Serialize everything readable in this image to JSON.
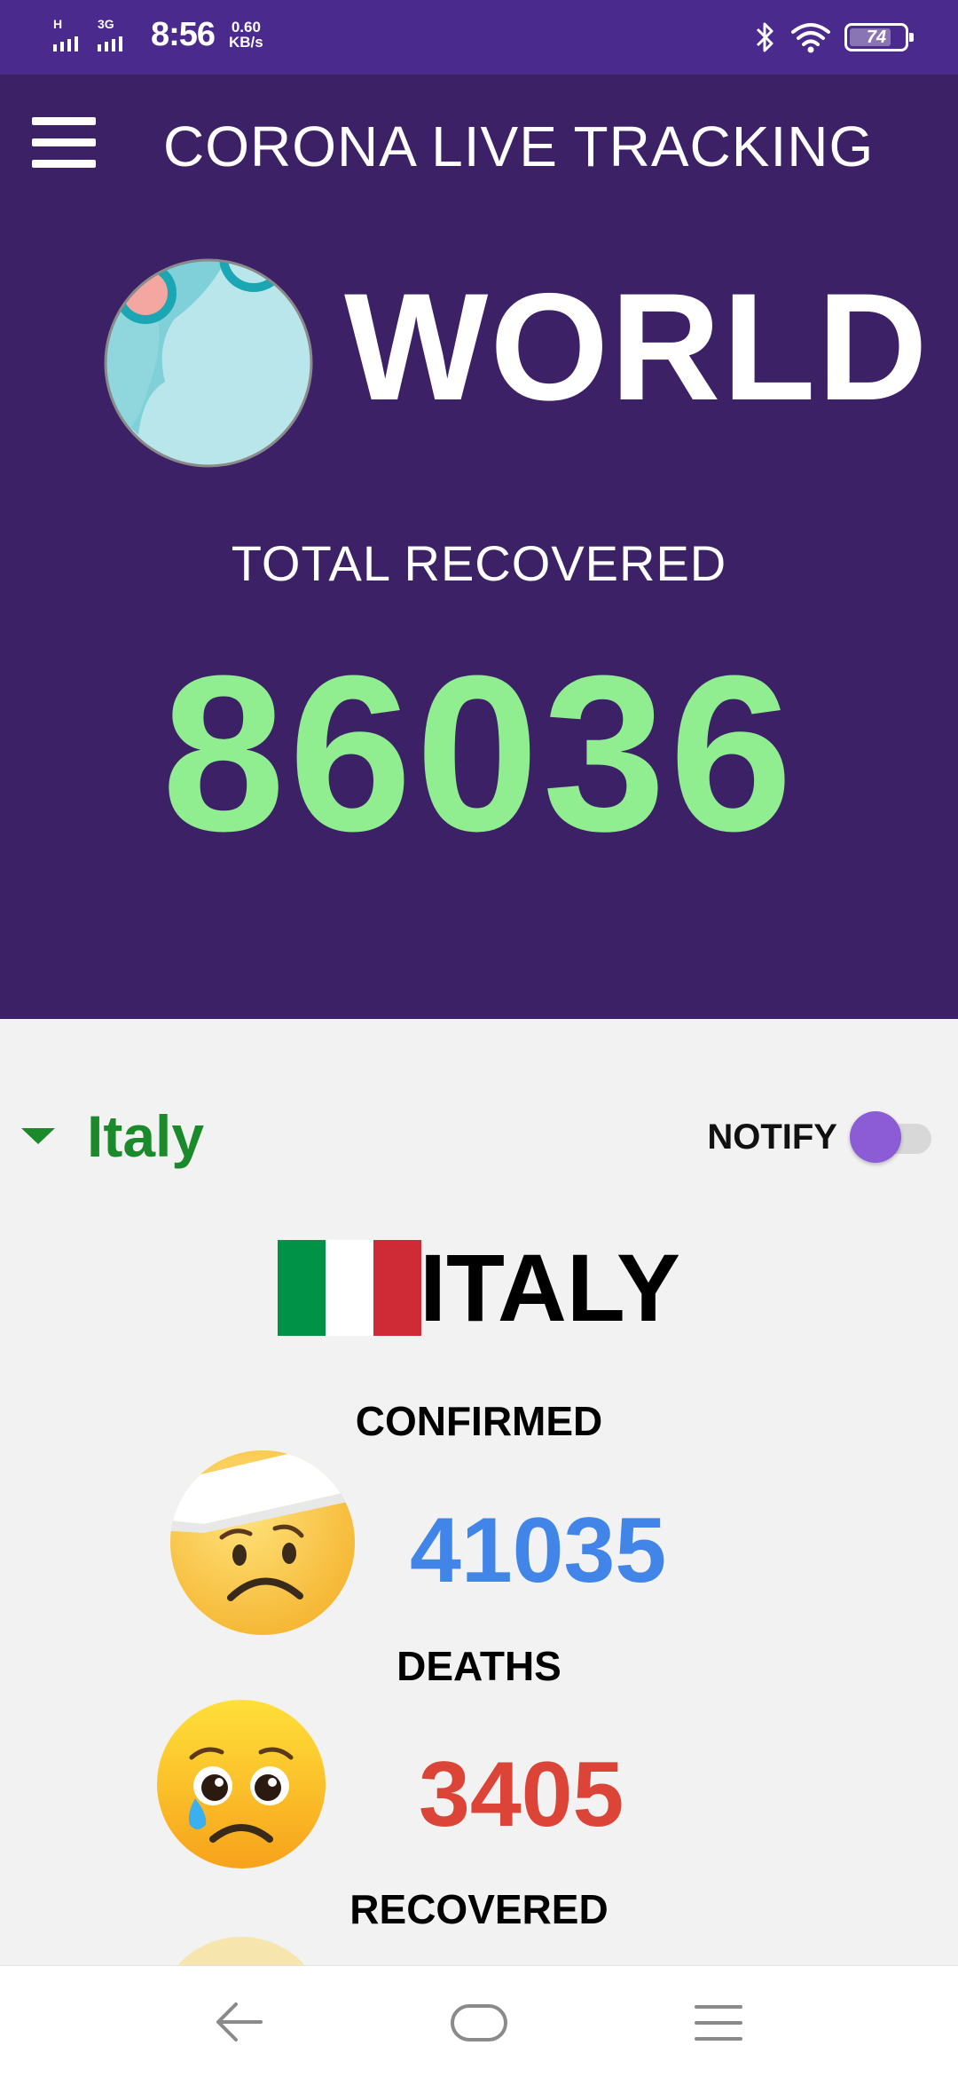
{
  "status_bar": {
    "signal_1_label": "H",
    "signal_2_label": "3G",
    "time": "8:56",
    "net_speed_value": "0.60",
    "net_speed_unit": "KB/s",
    "battery": "74",
    "icons": [
      "bluetooth-icon",
      "wifi-icon",
      "battery-icon"
    ]
  },
  "header": {
    "menu_icon": "hamburger-menu-icon",
    "title": "CORONA LIVE TRACKING"
  },
  "world": {
    "name": "WORLD",
    "icon": "globe-icon",
    "total_label": "TOTAL RECOVERED",
    "total_value": "86036"
  },
  "country_selector": {
    "selected": "Italy",
    "icon": "caret-down-icon"
  },
  "notify": {
    "label": "NOTIFY",
    "enabled": false
  },
  "country": {
    "name": "ITALY",
    "flag_icon": "italy-flag-icon",
    "stats": [
      {
        "label": "CONFIRMED",
        "value": "41035",
        "color": "#4285e8",
        "icon": "bandaged-face-emoji-icon"
      },
      {
        "label": "DEATHS",
        "value": "3405",
        "color": "#db4437",
        "icon": "crying-face-emoji-icon"
      },
      {
        "label": "RECOVERED",
        "icon": "smiling-face-emoji-icon"
      }
    ]
  },
  "nav": {
    "icons": [
      "back-icon",
      "home-icon",
      "recents-icon"
    ]
  },
  "colors": {
    "status_bar": "#4a2a8c",
    "hero_background": "#3c2166",
    "recovered_green": "#90ee90",
    "country_green": "#1a8a2a",
    "toggle_knob": "#8b5cd6"
  }
}
